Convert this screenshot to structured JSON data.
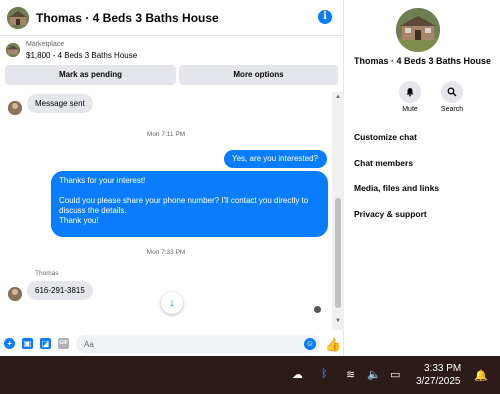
{
  "header": {
    "title": "Thomas · 4 Beds 3 Baths House",
    "info_icon": "info-icon"
  },
  "marketplace": {
    "label": "Marketplace",
    "item": "$1,800 - 4 Beds 3 Baths House",
    "pending_button": "Mark as pending",
    "more_button": "More options"
  },
  "messages": {
    "system_sent": "Message sent",
    "ts1": "Mon 7:11 PM",
    "out1": "Yes, are you interested?",
    "out2_line1": "Thanks for your interest!",
    "out2_line2": "Could you please share your phone number? I'll contact you directly to discuss the details.",
    "out2_line3": "Thank you!",
    "ts2": "Mon 7:33 PM",
    "sender": "Thomas",
    "in1": "616-291-3815"
  },
  "composer": {
    "placeholder": "Aa"
  },
  "side": {
    "name": "Thomas · 4 Beds 3 Baths House",
    "mute_label": "Mute",
    "search_label": "Search",
    "menu": [
      "Customize chat",
      "Chat members",
      "Media, files and links",
      "Privacy & support"
    ]
  },
  "taskbar": {
    "time": "3:33 PM",
    "date": "3/27/2025"
  },
  "colors": {
    "accent": "#0a7cff",
    "taskbar": "#2d1b19",
    "bubble_in": "#e4e6eb"
  }
}
